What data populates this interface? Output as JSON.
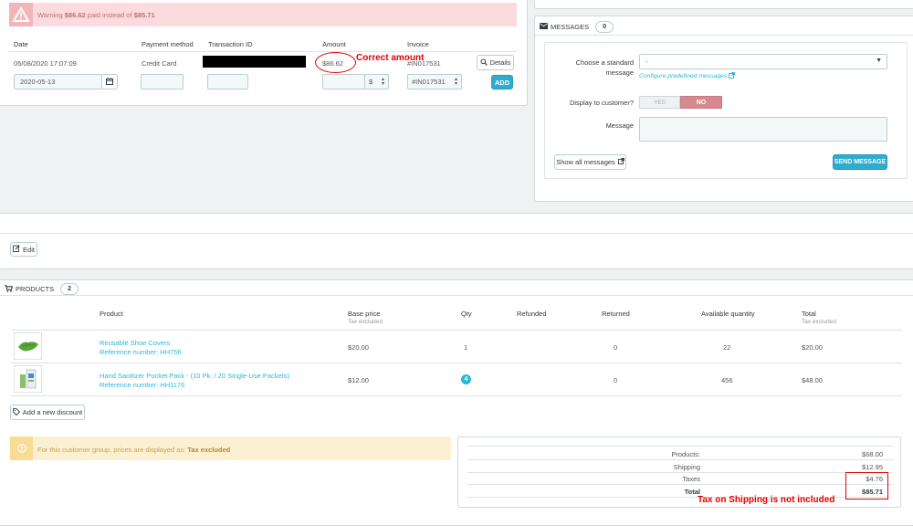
{
  "payment": {
    "warning": {
      "prefix": "Warning",
      "paid": "$86.62",
      "middle": "paid instead of",
      "expected": "$85.71"
    },
    "headers": {
      "date": "Date",
      "method": "Payment method",
      "transaction": "Transaction ID",
      "amount": "Amount",
      "invoice": "Invoice"
    },
    "row": {
      "date": "05/08/2020 17:07:09",
      "method": "Credit Card",
      "amount": "$86.62",
      "invoice": "#IN017531",
      "details": "Details"
    },
    "form": {
      "date": "2020-05-13",
      "currency": "$",
      "invoice": "#IN017531",
      "add": "ADD"
    }
  },
  "annotations": {
    "correct_amount": "Correct amount",
    "tax_note": "Tax on Shipping is not included"
  },
  "messages": {
    "title": "MESSAGES",
    "count": "0",
    "choose_label": "Choose a standard message",
    "select_value": "-",
    "configure_link": "Configure predefined messages",
    "display_label": "Display to customer?",
    "yes": "YES",
    "no": "NO",
    "message_label": "Message",
    "show_all": "Show all messages",
    "send": "SEND MESSAGE"
  },
  "edit_button": "Edit",
  "products": {
    "title": "PRODUCTS",
    "count": "2",
    "headers": {
      "product": "Product",
      "base_price": "Base price",
      "base_price_sub": "Tax excluded",
      "qty": "Qty",
      "refunded": "Refunded",
      "returned": "Returned",
      "available": "Available quantity",
      "total": "Total",
      "total_sub": "Tax excluded"
    },
    "rows": [
      {
        "name": "Reusable Shoe Covers",
        "ref": "Reference number: HH756",
        "price": "$20.00",
        "qty": "1",
        "returned": "0",
        "available": "22",
        "total": "$20.00"
      },
      {
        "name": "Hand Sanitizer Pocket Pack - (10 Pk. / 20 Single-Use Packets)",
        "ref": "Reference number: HH1176",
        "price": "$12.00",
        "qty": "4",
        "returned": "0",
        "available": "456",
        "total": "$48.00"
      }
    ],
    "add_discount": "Add a new discount"
  },
  "tax_notice": {
    "text": "For this customer group, prices are displayed as:",
    "strong": "Tax excluded"
  },
  "totals": [
    {
      "label": "Products:",
      "value": "$68.00"
    },
    {
      "label": "Shipping",
      "value": "$12.95"
    },
    {
      "label": "Taxes",
      "value": "$4.76"
    },
    {
      "label": "Total",
      "value": "$85.71"
    }
  ],
  "colors": {
    "accent": "#25b9d7",
    "danger_bg": "#fbdbdd",
    "warning_bg": "#fcf0d3",
    "annotation": "#e10000"
  }
}
